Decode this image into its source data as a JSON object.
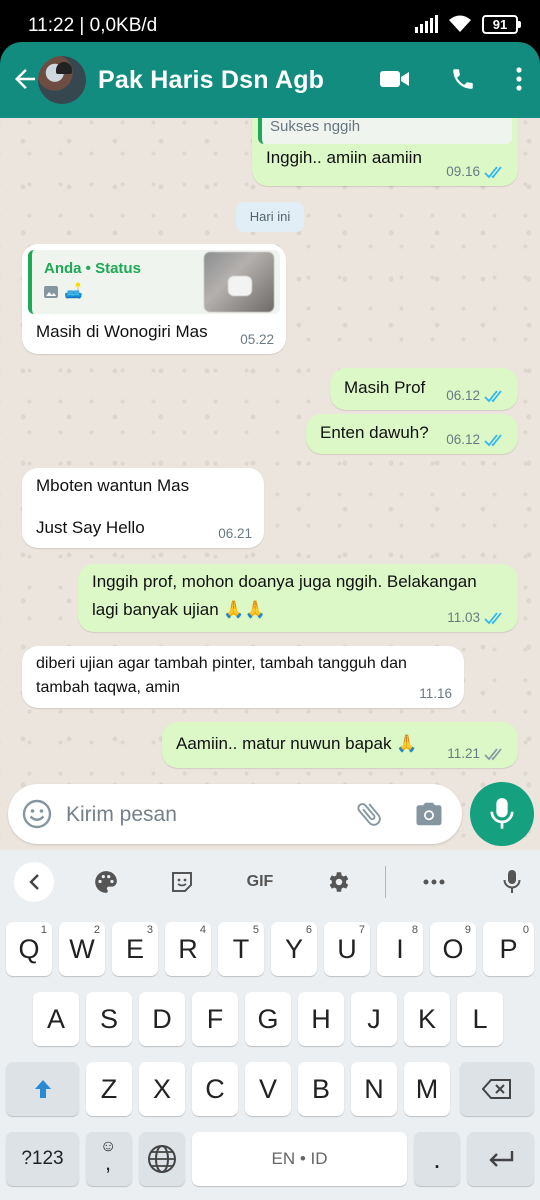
{
  "statusbar": {
    "time": "11:22 | 0,0KB/d",
    "battery": "91"
  },
  "header": {
    "contact_name": "Pak Haris Dsn Agb"
  },
  "chat": {
    "prev_quote_text": "Sukses nggih",
    "prev_msg": {
      "text": "Inggih.. amiin aamiin",
      "time": "09.16"
    },
    "day_separator": "Hari ini",
    "status_reply": {
      "quote_sender": "Anda",
      "quote_label": "Status",
      "text": "Masih di Wonogiri Mas",
      "time": "05.22"
    },
    "messages": [
      {
        "dir": "out",
        "text": "Masih Prof",
        "time": "06.12"
      },
      {
        "dir": "out",
        "text": "Enten dawuh?",
        "time": "06.12"
      },
      {
        "dir": "in",
        "line1": "Mboten wantun Mas",
        "line2": "Just Say Hello",
        "time": "06.21"
      },
      {
        "dir": "out",
        "line1": "Inggih prof, mohon doanya juga nggih. Belakangan",
        "line2": "lagi banyak ujian 🙏🙏",
        "time": "11.03"
      },
      {
        "dir": "in",
        "line1": "diberi ujian agar tambah pinter, tambah tangguh dan",
        "line2": "tambah taqwa, amin",
        "time": "11.16"
      },
      {
        "dir": "out",
        "text": "Aamiin.. matur nuwun bapak 🙏",
        "time": "11.21"
      }
    ]
  },
  "composer": {
    "placeholder": "Kirim pesan"
  },
  "keyboard": {
    "row1": [
      [
        "Q",
        "1"
      ],
      [
        "W",
        "2"
      ],
      [
        "E",
        "3"
      ],
      [
        "R",
        "4"
      ],
      [
        "T",
        "5"
      ],
      [
        "Y",
        "6"
      ],
      [
        "U",
        "7"
      ],
      [
        "I",
        "8"
      ],
      [
        "O",
        "9"
      ],
      [
        "P",
        "0"
      ]
    ],
    "row2": [
      "A",
      "S",
      "D",
      "F",
      "G",
      "H",
      "J",
      "K",
      "L"
    ],
    "row3": [
      "Z",
      "X",
      "C",
      "V",
      "B",
      "N",
      "M"
    ],
    "symbols_label": "?123",
    "comma": ",",
    "space_label": "EN • ID",
    "period": ".",
    "gif_label": "GIF"
  },
  "colors": {
    "header": "#128C7E",
    "outgoing": "#dcf8c6",
    "incoming": "#ffffff",
    "tick_read": "#34B7F1",
    "tick_sent": "#8a9aa3",
    "mic": "#15a07f"
  }
}
